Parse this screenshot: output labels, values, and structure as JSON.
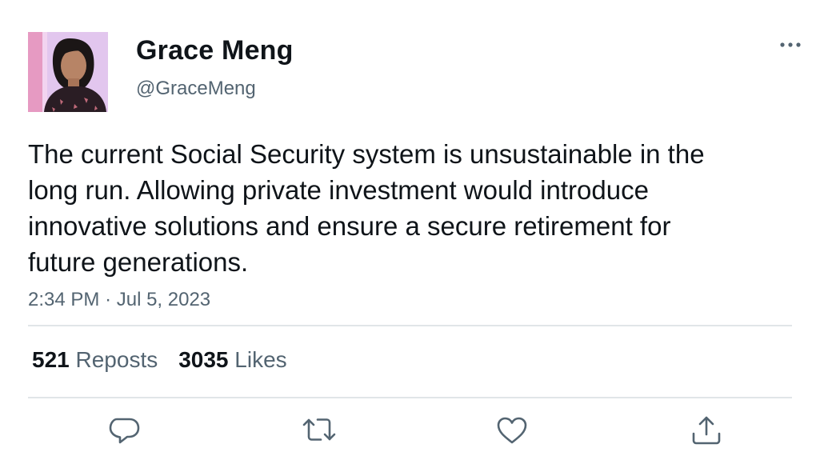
{
  "author": {
    "display_name": "Grace Meng",
    "handle": "@GraceMeng"
  },
  "tweet": {
    "text": "The current Social Security system is unsustainable in the long run. Allowing private investment would introduce innovative solutions and ensure a secure retirement for future generations.",
    "time": "2:34 PM",
    "separator": "·",
    "date": "Jul 5, 2023"
  },
  "stats": {
    "reposts_count": "521",
    "reposts_label": "Reposts",
    "likes_count": "3035",
    "likes_label": "Likes"
  },
  "icons": {
    "more": "more-horizontal-icon",
    "reply": "reply-bubble-icon",
    "repost": "repost-arrows-icon",
    "like": "heart-icon",
    "share": "share-upload-icon"
  },
  "colors": {
    "text_primary": "#0f1419",
    "text_secondary": "#536471",
    "divider": "#e1e5e8"
  }
}
